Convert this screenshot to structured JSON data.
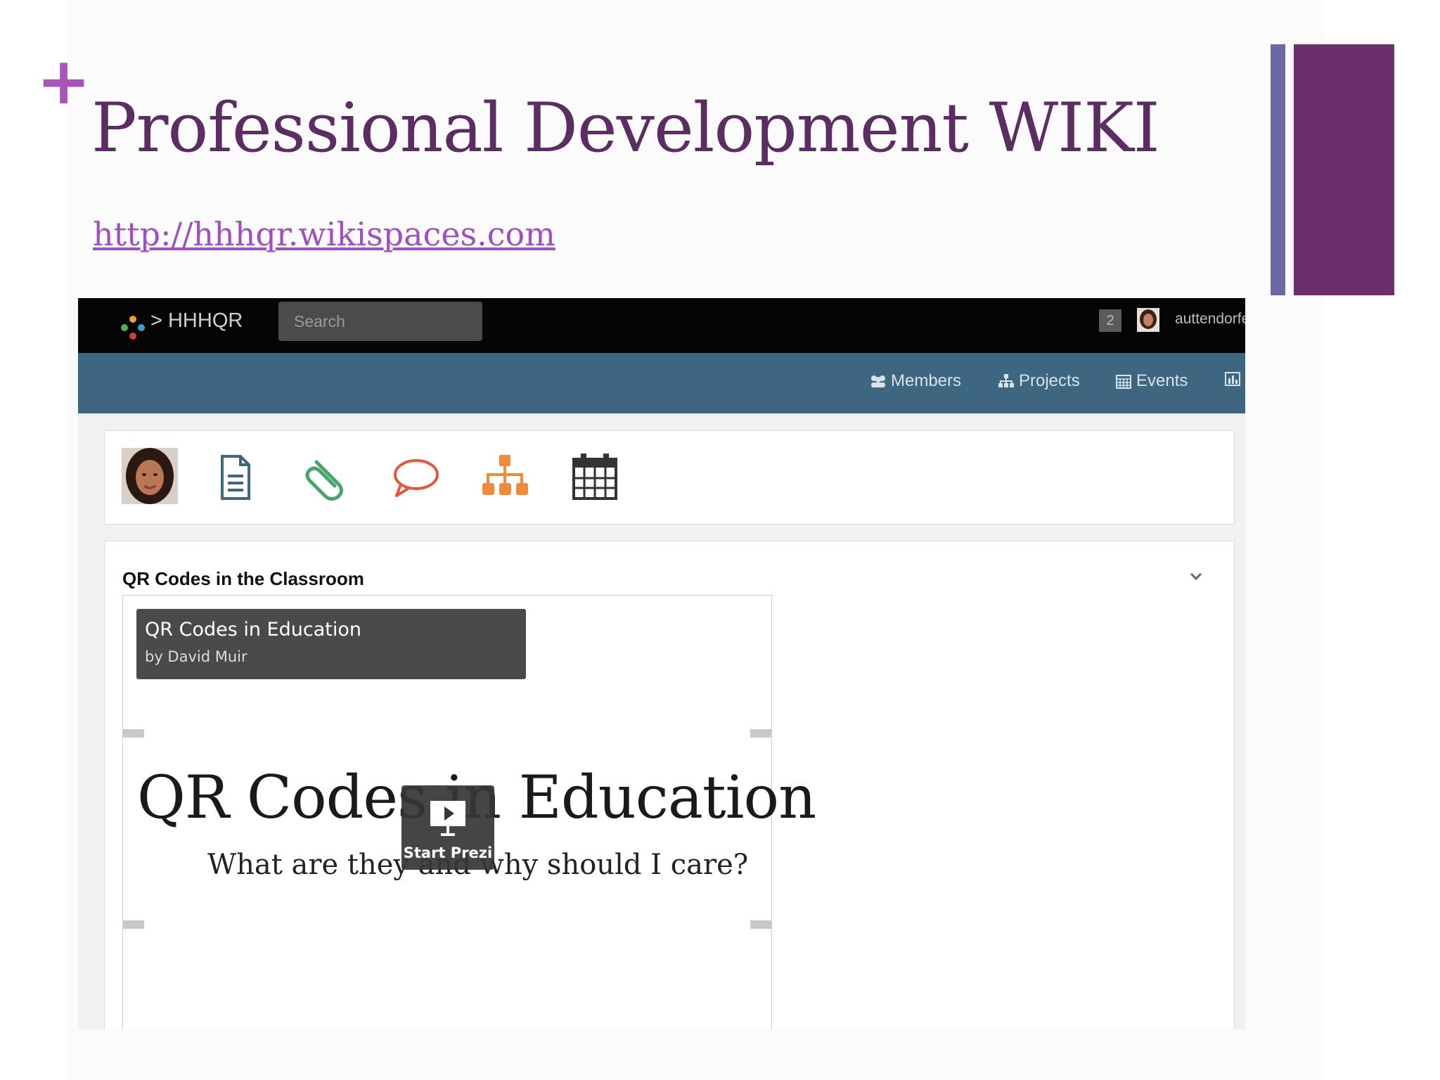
{
  "slide": {
    "plus_mark": "+",
    "title": "Professional Development WIKI",
    "link": "http://hhhqr.wikispaces.com"
  },
  "wiki": {
    "brand": "> HHHQR",
    "search_placeholder": "Search",
    "notification_count": "2",
    "username": "auttendorfe",
    "nav": {
      "members": "Members",
      "projects": "Projects",
      "events": "Events"
    },
    "toolbar_icons": [
      "user-avatar",
      "page-icon",
      "attachment-icon",
      "comment-icon",
      "hierarchy-icon",
      "calendar-icon"
    ],
    "section_title": "QR Codes in the Classroom",
    "prezi": {
      "title": "QR Codes in Education",
      "author": "by David Muir",
      "heading": "QR Codes in Education",
      "subheading": "What are they and why should I care?",
      "start_label": "Start Prezi"
    }
  },
  "colors": {
    "title": "#5b2d63",
    "link": "#9f4fbf",
    "plus": "#a855b8",
    "accent_bar_thin": "#6a6aa2",
    "accent_bar_thick": "#6b2f6b",
    "navbar": "#3d6680",
    "topbar": "#050505"
  }
}
